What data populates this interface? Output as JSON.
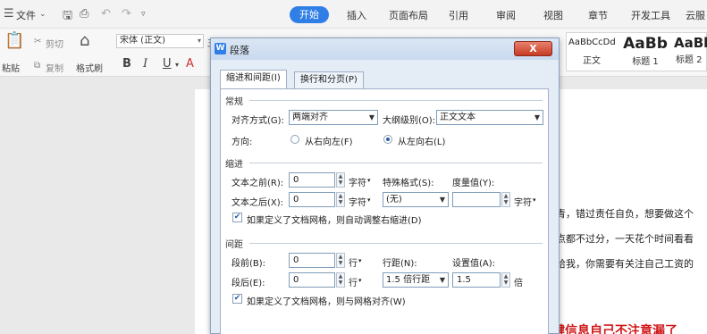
{
  "menubar": {
    "file": "文件",
    "tabs": [
      "开始",
      "插入",
      "页面布局",
      "引用",
      "审阅",
      "视图",
      "章节",
      "开发工具",
      "云服"
    ]
  },
  "ribbon": {
    "paste": "粘贴",
    "cut": "剪切",
    "copy": "复制",
    "format_painter": "格式刷",
    "font_name": "宋体 (正文)",
    "font_size_partial": "五号",
    "bold": "B",
    "italic": "I",
    "underline": "U",
    "styles": [
      {
        "preview": "AaBbCcDd",
        "name": "正文"
      },
      {
        "preview": "AaBb",
        "name": "标题 1"
      },
      {
        "preview": "AaBl",
        "name": "标题 2"
      }
    ]
  },
  "document": {
    "lines": [
      "青，错过责任自负，想要做这个",
      "点都不过分，一天花个时间看看",
      "给我，你需要有关注自己工资的"
    ],
    "red_line": "键信息自己不注意漏了"
  },
  "dialog": {
    "title": "段落",
    "close": "X",
    "tabs": [
      "缩进和间距(I)",
      "换行和分页(P)"
    ],
    "general": {
      "section": "常规",
      "alignment_label": "对齐方式(G):",
      "alignment_value": "两端对齐",
      "outline_label": "大纲级别(O):",
      "outline_value": "正文文本",
      "direction_label": "方向:",
      "rtl": "从右向左(F)",
      "ltr": "从左向右(L)"
    },
    "indent": {
      "section": "缩进",
      "before_label": "文本之前(R):",
      "before_value": "0",
      "before_unit": "字符",
      "after_label": "文本之后(X):",
      "after_value": "0",
      "after_unit": "字符",
      "special_label": "特殊格式(S):",
      "special_value": "(无)",
      "measure_label": "度量值(Y):",
      "measure_value": "",
      "measure_unit": "字符",
      "auto_adjust": "如果定义了文档网格，则自动调整右缩进(D)"
    },
    "spacing": {
      "section": "间距",
      "before_label": "段前(B):",
      "before_value": "0",
      "before_unit": "行",
      "after_label": "段后(E):",
      "after_value": "0",
      "after_unit": "行",
      "line_label": "行距(N):",
      "line_value": "1.5 倍行距",
      "setting_label": "设置值(A):",
      "setting_value": "1.5",
      "setting_unit": "倍",
      "snap_grid": "如果定义了文档网格，则与网格对齐(W)"
    }
  }
}
